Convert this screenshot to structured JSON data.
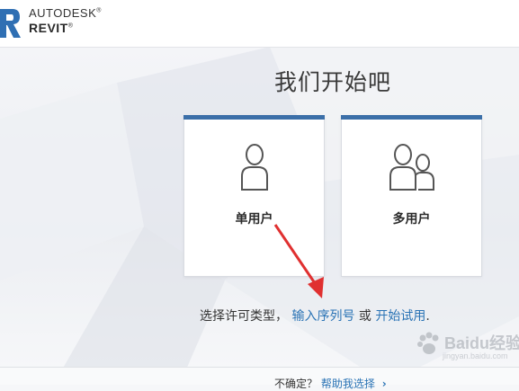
{
  "header": {
    "brand_top": "AUTODESK",
    "brand_bottom": "REVIT",
    "accent": "#3b6fa8"
  },
  "main": {
    "title": "我们开始吧",
    "cards": [
      {
        "label": "单用户",
        "icon": "single-user-icon"
      },
      {
        "label": "多用户",
        "icon": "multi-user-icon"
      }
    ],
    "license": {
      "prefix": "选择许可类型，",
      "serial_link": "输入序列号",
      "or": "或",
      "trial_link": "开始试用",
      "suffix": "."
    }
  },
  "footer": {
    "unsure": "不确定？",
    "help_link": "帮助我选择"
  },
  "watermark": {
    "text": "Baidu经验",
    "sub": "jingyan.baidu.com"
  }
}
